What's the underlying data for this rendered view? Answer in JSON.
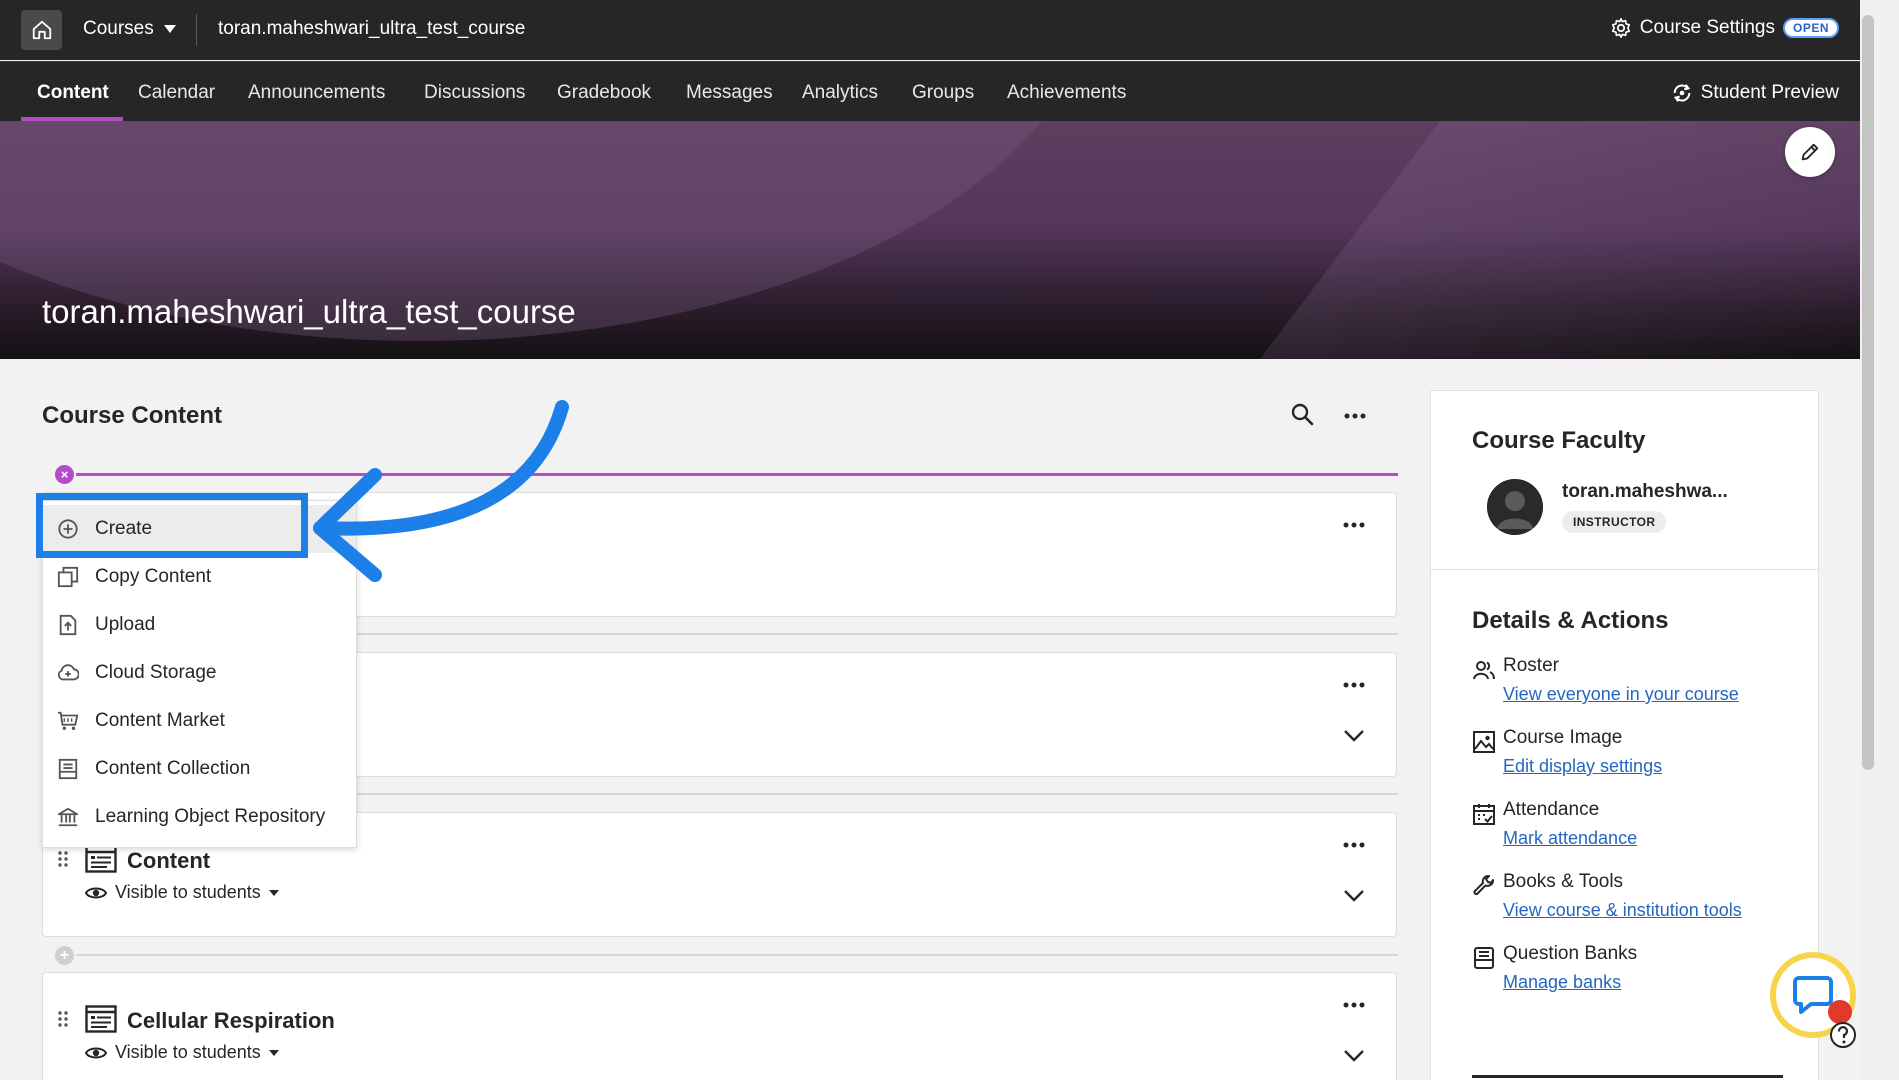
{
  "topbar": {
    "courses_label": "Courses",
    "course_name": "toran.maheshwari_ultra_test_course",
    "settings_label": "Course Settings",
    "open_badge": "OPEN"
  },
  "nav": {
    "tabs": [
      {
        "label": "Content",
        "active": true
      },
      {
        "label": "Calendar"
      },
      {
        "label": "Announcements"
      },
      {
        "label": "Discussions"
      },
      {
        "label": "Gradebook"
      },
      {
        "label": "Messages"
      },
      {
        "label": "Analytics"
      },
      {
        "label": "Groups"
      },
      {
        "label": "Achievements"
      }
    ],
    "student_preview": "Student Preview"
  },
  "banner": {
    "title": "toran.maheshwari_ultra_test_course"
  },
  "main": {
    "title": "Course Content",
    "menu": [
      {
        "label": "Create",
        "icon": "plus-circle-icon"
      },
      {
        "label": "Copy Content",
        "icon": "copy-icon"
      },
      {
        "label": "Upload",
        "icon": "upload-icon"
      },
      {
        "label": "Cloud Storage",
        "icon": "cloud-storage-icon"
      },
      {
        "label": "Content Market",
        "icon": "cart-icon"
      },
      {
        "label": "Content Collection",
        "icon": "collection-icon"
      },
      {
        "label": "Learning Object Repository",
        "icon": "repository-icon"
      }
    ],
    "items": [
      {
        "title": "Content",
        "visibility": "Visible to students"
      },
      {
        "title": "Cellular Respiration",
        "visibility": "Visible to students"
      }
    ]
  },
  "panel": {
    "faculty_title": "Course Faculty",
    "faculty_name": "toran.maheshwa...",
    "faculty_role": "INSTRUCTOR",
    "details_title": "Details & Actions",
    "actions": [
      {
        "title": "Roster",
        "link": "View everyone in your course",
        "icon": "roster-icon"
      },
      {
        "title": "Course Image",
        "link": "Edit display settings",
        "icon": "image-icon"
      },
      {
        "title": "Attendance",
        "link": "Mark attendance",
        "icon": "attendance-icon"
      },
      {
        "title": "Books & Tools",
        "link": "View course & institution tools",
        "icon": "wrench-icon"
      },
      {
        "title": "Question Banks",
        "link": "Manage banks",
        "icon": "question-bank-icon"
      }
    ]
  },
  "colors": {
    "accent": "#b54bc7",
    "callout": "#1d7fe8",
    "link": "#2466c1",
    "topbar": "#262626"
  }
}
